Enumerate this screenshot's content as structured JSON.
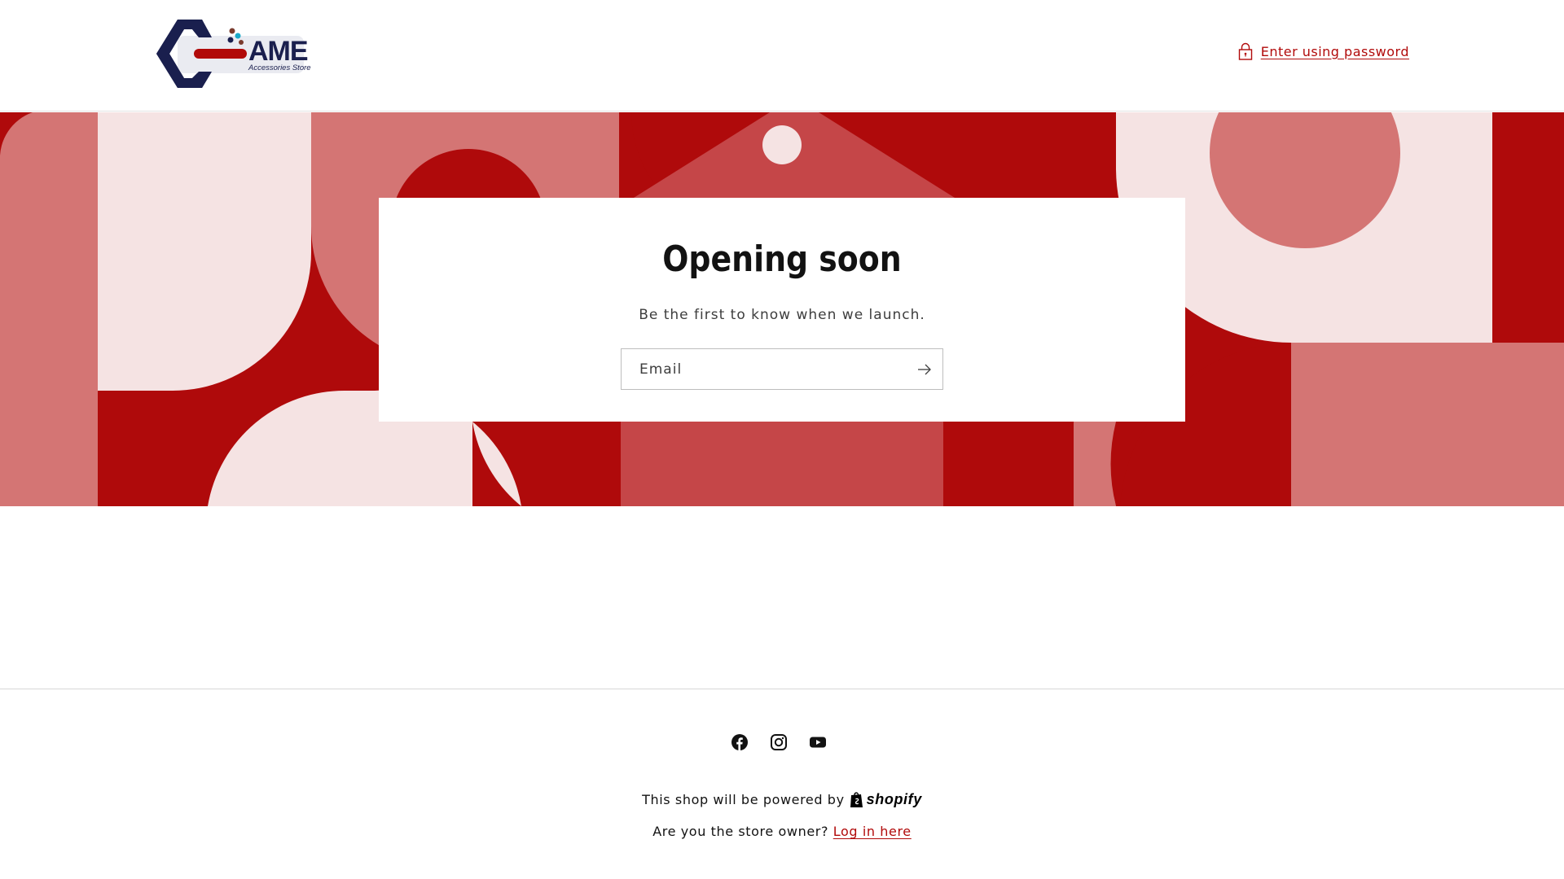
{
  "header": {
    "logo": {
      "main_text": "AME",
      "sub_text": "Accessories Store"
    },
    "password_link": "Enter using password",
    "password_icon": "lock-icon"
  },
  "colors": {
    "accent": "#b10a0a",
    "banner_dark": "#af0a0b",
    "banner_mid": "#d47574",
    "banner_red": "#c54648",
    "banner_light": "#f5e3e3",
    "logo_navy": "#1a1f4e"
  },
  "main": {
    "title": "Opening soon",
    "subtitle": "Be the first to know when we launch.",
    "email_placeholder": "Email",
    "submit_icon": "arrow-right-icon"
  },
  "footer": {
    "social": [
      {
        "name": "facebook-icon"
      },
      {
        "name": "instagram-icon"
      },
      {
        "name": "youtube-icon"
      }
    ],
    "powered_text": "This shop will be powered by",
    "shopify_text": "shopify",
    "owner_text": "Are you the store owner?",
    "login_text": "Log in here"
  }
}
